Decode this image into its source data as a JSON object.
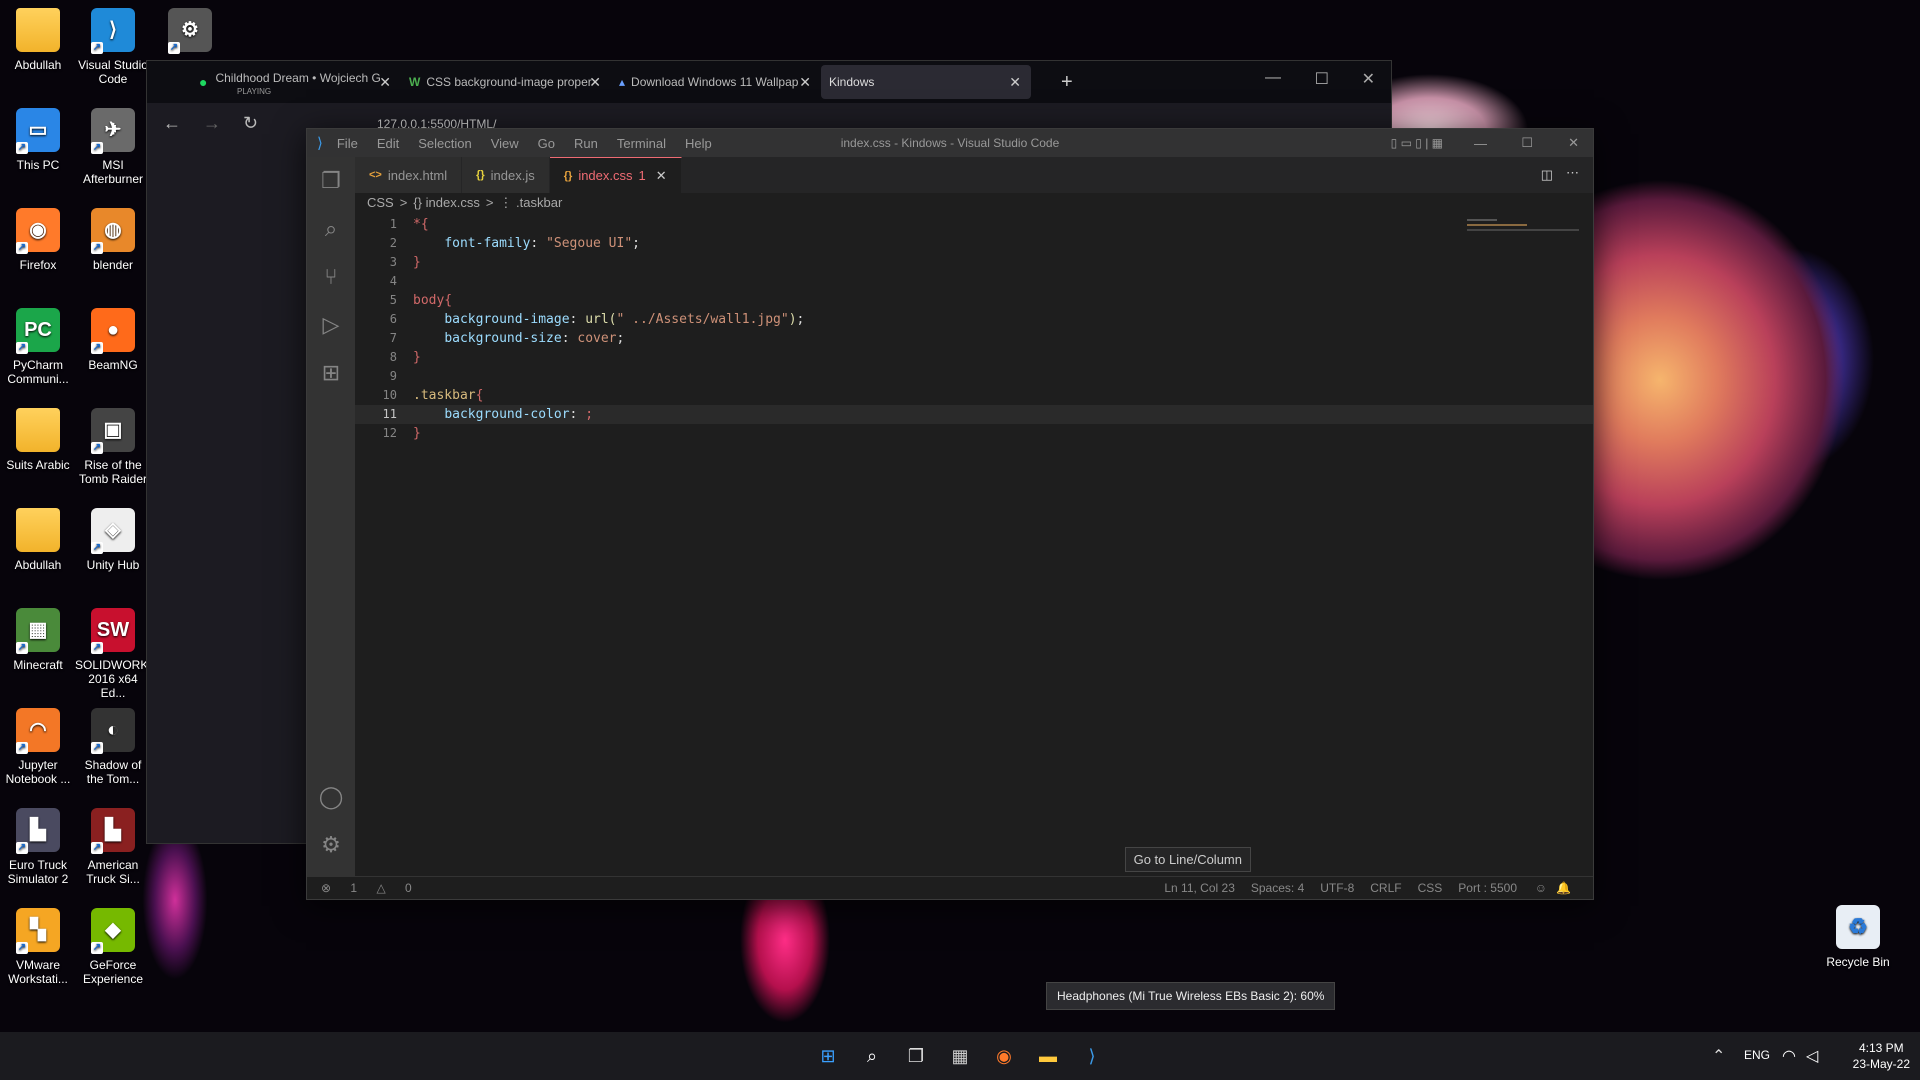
{
  "desktop": {
    "icons": [
      {
        "label": "Abdullah",
        "glyph": "",
        "kind": "folder"
      },
      {
        "label": "Visual Studio Code",
        "glyph": "⟩",
        "kind": "app"
      },
      {
        "label": "",
        "glyph": "⚙",
        "kind": "app"
      },
      {
        "label": "This PC",
        "glyph": "▭",
        "kind": "app"
      },
      {
        "label": "MSI Afterburner",
        "glyph": "✈",
        "kind": "app"
      },
      {
        "label": "Firefox",
        "glyph": "◉",
        "kind": "app"
      },
      {
        "label": "blender",
        "glyph": "◍",
        "kind": "app"
      },
      {
        "label": "PyCharm Communi...",
        "glyph": "PC",
        "kind": "app"
      },
      {
        "label": "BeamNG",
        "glyph": "●",
        "kind": "app"
      },
      {
        "label": "Suits Arabic",
        "glyph": "",
        "kind": "folder"
      },
      {
        "label": "Rise of the Tomb Raider",
        "glyph": "▣",
        "kind": "app"
      },
      {
        "label": "Abdullah",
        "glyph": "",
        "kind": "folder"
      },
      {
        "label": "Unity Hub",
        "glyph": "◈",
        "kind": "app"
      },
      {
        "label": "Minecraft",
        "glyph": "▦",
        "kind": "app"
      },
      {
        "label": "SOLIDWORKS 2016 x64 Ed...",
        "glyph": "SW",
        "kind": "app"
      },
      {
        "label": "Jupyter Notebook ...",
        "glyph": "◠",
        "kind": "app"
      },
      {
        "label": "Shadow of the Tom...",
        "glyph": "◐",
        "kind": "app"
      },
      {
        "label": "Euro Truck Simulator 2",
        "glyph": "▙",
        "kind": "app"
      },
      {
        "label": "American Truck Si...",
        "glyph": "▙",
        "kind": "app"
      },
      {
        "label": "VMware Workstati...",
        "glyph": "▚",
        "kind": "app"
      },
      {
        "label": "GeForce Experience",
        "glyph": "◆",
        "kind": "app"
      }
    ],
    "recycle_bin": "Recycle Bin"
  },
  "browser": {
    "tabs": [
      {
        "title": "Childhood Dream • Wojciech G",
        "sub": "PLAYING",
        "icon": "spotify-icon"
      },
      {
        "title": "CSS background-image proper",
        "icon": "w3schools-icon"
      },
      {
        "title": "Download Windows 11 Wallpap",
        "icon": "site-icon"
      },
      {
        "title": "Kindows",
        "icon": ""
      }
    ],
    "new_tab": "+",
    "url": "127.0.0.1:5500/HTML/"
  },
  "vscode": {
    "menu": [
      "File",
      "Edit",
      "Selection",
      "View",
      "Go",
      "Run",
      "Terminal",
      "Help"
    ],
    "title": "index.css - Kindows - Visual Studio Code",
    "tabs": [
      {
        "label": "index.html",
        "icon": "<>"
      },
      {
        "label": "index.js",
        "icon": "{}"
      },
      {
        "label": "index.css",
        "icon": "{}",
        "badge": "1",
        "active": true
      }
    ],
    "breadcrumb": [
      "CSS",
      ">",
      "{} index.css",
      ">",
      "⋮ .taskbar"
    ],
    "lines": [
      {
        "n": "1",
        "html": "<span class='kw'>*</span><span class='kw'>{</span>"
      },
      {
        "n": "2",
        "html": "    <span class='prop'>font-family</span>: <span class='str'>\"Segoue UI\"</span>;"
      },
      {
        "n": "3",
        "html": "<span class='kw'>}</span>"
      },
      {
        "n": "4",
        "html": ""
      },
      {
        "n": "5",
        "html": "<span class='kw'>body{</span>"
      },
      {
        "n": "6",
        "html": "    <span class='prop'>background-image</span>: <span class='fn'>url(</span><span class='str'>\" ../Assets/wall1.jpg\"</span><span class='fn'>)</span>;"
      },
      {
        "n": "7",
        "html": "    <span class='prop'>background-size</span>: <span class='val'>cover</span>;"
      },
      {
        "n": "8",
        "html": "<span class='kw'>}</span>"
      },
      {
        "n": "9",
        "html": ""
      },
      {
        "n": "10",
        "html": "<span class='sel'>.taskbar</span><span class='kw'>{</span>"
      },
      {
        "n": "11",
        "html": "    <span class='prop'>background-color</span>: <span class='kw'>;</span>"
      },
      {
        "n": "12",
        "html": "<span class='kw'>}</span>"
      }
    ],
    "tooltip": "Go to Line/Column",
    "status_left": {
      "errors": "1",
      "warnings": "0"
    },
    "status_right": [
      "Ln 11, Col 23",
      "Spaces: 4",
      "UTF-8",
      "CRLF",
      "CSS",
      "Port : 5500"
    ]
  },
  "notification": "Headphones (Mi True Wireless EBs Basic 2): 60%",
  "taskbar": {
    "lang": "ENG",
    "time": "4:13 PM",
    "date": "23-May-22"
  }
}
